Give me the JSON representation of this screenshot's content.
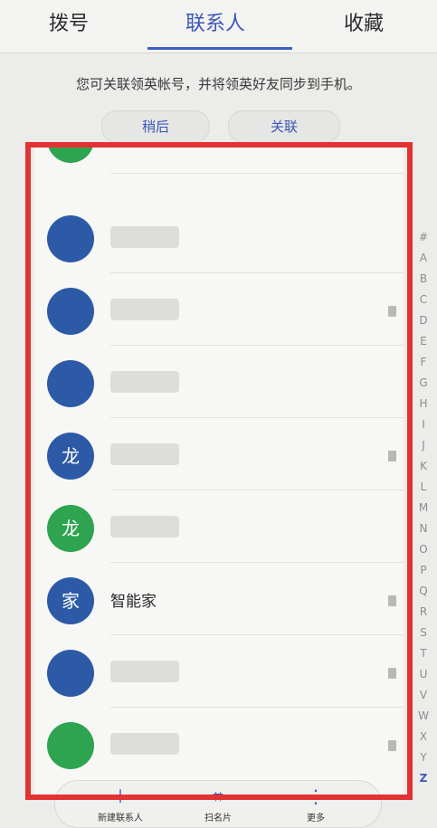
{
  "tabs": [
    {
      "label": "拨号",
      "active": false
    },
    {
      "label": "联系人",
      "active": true
    },
    {
      "label": "收藏",
      "active": false
    }
  ],
  "banner": {
    "text": "您可关联领英帐号，并将领英好友同步到手机。",
    "later_label": "稍后",
    "link_label": "关联"
  },
  "contacts": [
    {
      "avatar_text": "",
      "avatar_color": "#2ea350",
      "name": ""
    },
    {
      "avatar_text": "",
      "avatar_color": "#2d5aa6",
      "name": ""
    },
    {
      "avatar_text": "",
      "avatar_color": "#2d5aa6",
      "name": ""
    },
    {
      "avatar_text": "",
      "avatar_color": "#2d5aa6",
      "name": ""
    },
    {
      "avatar_text": "龙",
      "avatar_color": "#2d5aa6",
      "name": ""
    },
    {
      "avatar_text": "龙",
      "avatar_color": "#2ea350",
      "name": ""
    },
    {
      "avatar_text": "家",
      "avatar_color": "#2d5aa6",
      "name": "智能家"
    },
    {
      "avatar_text": "",
      "avatar_color": "#2d5aa6",
      "name": ""
    },
    {
      "avatar_text": "",
      "avatar_color": "#2ea350",
      "name": ""
    }
  ],
  "alpha_index": [
    "#",
    "A",
    "B",
    "C",
    "D",
    "E",
    "F",
    "G",
    "H",
    "I",
    "J",
    "K",
    "L",
    "M",
    "N",
    "O",
    "P",
    "Q",
    "R",
    "S",
    "T",
    "U",
    "V",
    "W",
    "X",
    "Y",
    "Z"
  ],
  "bottom_bar": {
    "new_contact_label": "新建联系人",
    "scan_card_label": "扫名片",
    "more_label": "更多"
  },
  "colors": {
    "accent": "#3d5fc6",
    "highlight": "#e33232"
  }
}
